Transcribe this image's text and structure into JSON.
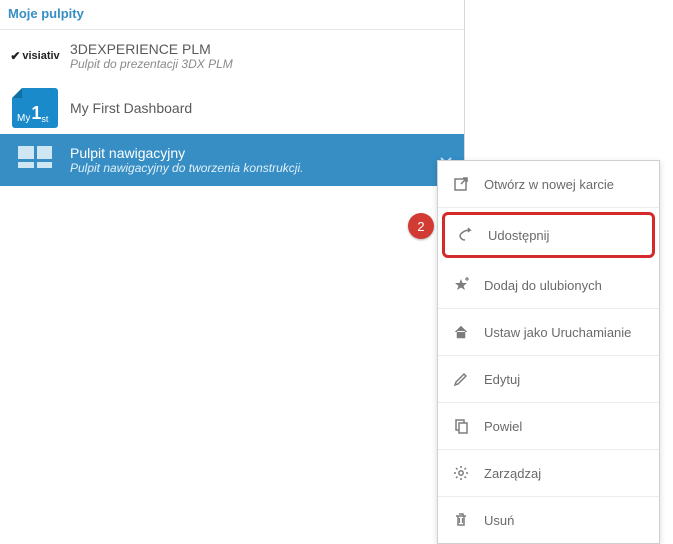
{
  "header": {
    "my_dashboards": "Moje pulpity"
  },
  "dashboards": [
    {
      "brand_prefix": "✔",
      "brand": "visiativ",
      "title": "3DEXPERIENCE PLM",
      "subtitle": "Pulpit do prezentacji 3DX PLM"
    },
    {
      "thumb_my": "My",
      "thumb_1": "1",
      "thumb_st": "st",
      "title": "My First Dashboard",
      "subtitle": ""
    },
    {
      "title": "Pulpit nawigacyjny",
      "subtitle": "Pulpit nawigacyjny do tworzenia konstrukcji."
    }
  ],
  "menu": {
    "open_new_tab": "Otwórz w nowej karcie",
    "share": "Udostępnij",
    "add_favorite": "Dodaj do ulubionych",
    "set_startup": "Ustaw jako Uruchamianie",
    "edit": "Edytuj",
    "duplicate": "Powiel",
    "manage": "Zarządzaj",
    "delete": "Usuń"
  },
  "badge": {
    "number": "2"
  }
}
